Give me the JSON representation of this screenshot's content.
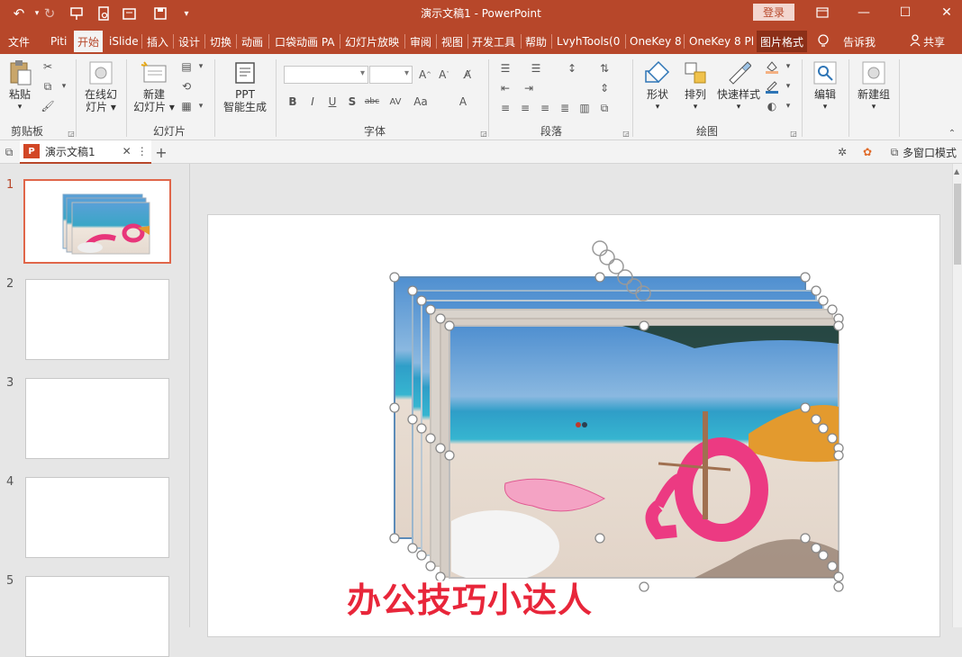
{
  "titlebar": {
    "title": "演示文稿1  -  PowerPoint",
    "login": "登录"
  },
  "tabs": [
    "文件",
    "Piti",
    "开始",
    "iSlide",
    "插入",
    "设计",
    "切换",
    "动画",
    "口袋动画 PA",
    "幻灯片放映",
    "审阅",
    "视图",
    "开发工具",
    "帮助",
    "LvyhTools(0",
    "OneKey 8",
    "OneKey 8 Pl",
    "图片格式",
    "告诉我",
    "共享"
  ],
  "ribbon": {
    "clipboard": {
      "paste": "粘贴",
      "label": "剪贴板"
    },
    "online_slides": {
      "line1": "在线幻",
      "line2": "灯片"
    },
    "slides": {
      "new_line1": "新建",
      "new_line2": "幻灯片",
      "label": "幻灯片"
    },
    "ppt_gen": {
      "line1": "PPT",
      "line2": "智能生成"
    },
    "font": {
      "label": "字体"
    },
    "paragraph": {
      "label": "段落"
    },
    "drawing": {
      "shape": "形状",
      "arrange": "排列",
      "quick_style": "快速样式",
      "label": "绘图"
    },
    "edit": {
      "label": "编辑"
    },
    "newgroup": {
      "label": "新建组"
    }
  },
  "docbar": {
    "tab_title": "演示文稿1",
    "multiwindow": "多窗口模式"
  },
  "slides": [
    "1",
    "2",
    "3",
    "4",
    "5"
  ],
  "watermark": "办公技巧小达人",
  "colors": {
    "accent": "#b7472a",
    "selection": "#e0664a"
  }
}
